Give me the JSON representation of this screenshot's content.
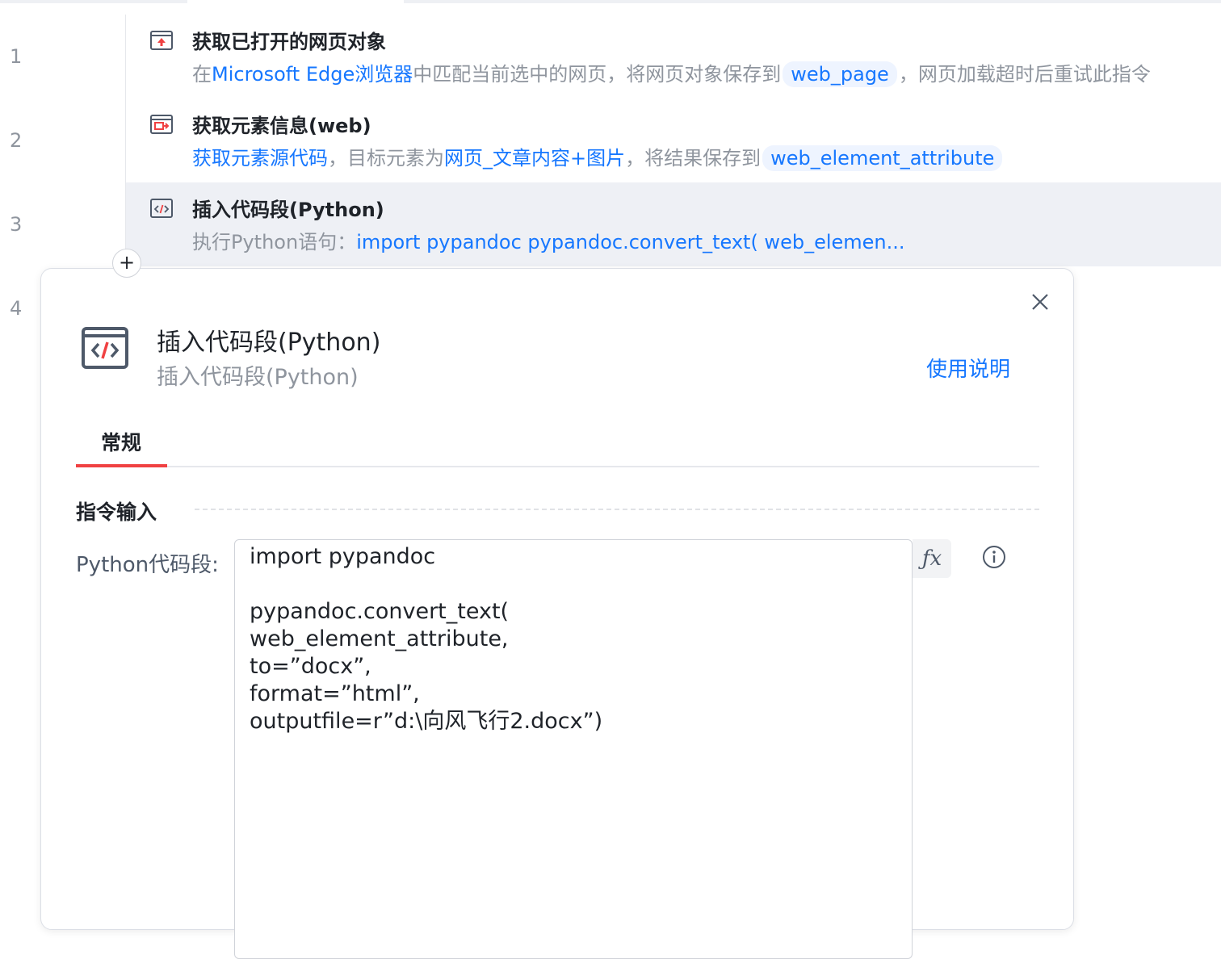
{
  "line_numbers": [
    "1",
    "2",
    "3",
    "4"
  ],
  "steps": [
    {
      "icon": "browser-open-icon",
      "title": "获取已打开的网页对象",
      "desc": {
        "p1": "在",
        "browser": "Microsoft Edge浏览器",
        "p2": "中匹配当前选中的网页，将网页对象保存到",
        "var": "web_page",
        "p3": "，网页加载超时后重试此指令"
      }
    },
    {
      "icon": "element-info-icon",
      "title": "获取元素信息(web)",
      "desc": {
        "action": "获取元素源代码",
        "p1": "，目标元素为",
        "target": "网页_文章内容+图片",
        "p2": "，将结果保存到",
        "var": "web_element_attribute"
      }
    },
    {
      "icon": "code-icon",
      "title": "插入代码段(Python)",
      "desc": {
        "p1": "执行Python语句：",
        "code": "import pypandoc  pypandoc.convert_text( web_elemen..."
      }
    }
  ],
  "add_button": "+",
  "dialog": {
    "title": "插入代码段(Python)",
    "subtitle": "插入代码段(Python)",
    "help": "使用说明",
    "tab": "常规",
    "section": "指令输入",
    "field_label": "Python代码段:",
    "code": "import pypandoc\n\npypandoc.convert_text(\nweb_element_attribute,\nto=”docx”,\nformat=”html”,\noutputfile=r”d:\\向风飞行2.docx”)",
    "fx": "ƒx"
  },
  "colors": {
    "link": "#1677ff",
    "accent_tab": "#f04142",
    "selected_row": "#eef0f5",
    "muted_text": "#8f959e"
  }
}
